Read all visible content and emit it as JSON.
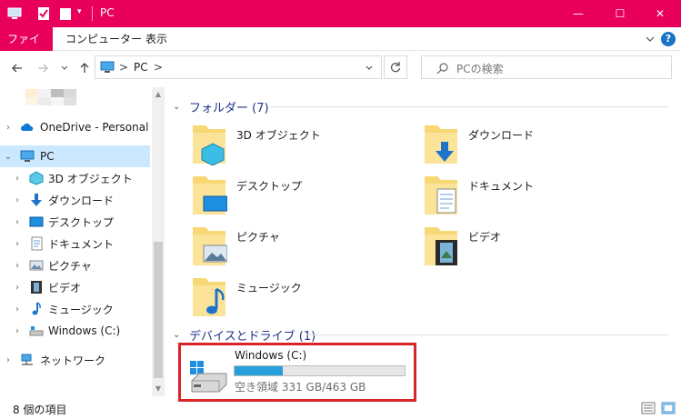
{
  "window": {
    "title": "PC",
    "minimize_glyph": "—",
    "maximize_glyph": "☐",
    "close_glyph": "✕",
    "accent": "#e8005a"
  },
  "ribbon": {
    "tabs": [
      "ファイル",
      "コンピューター",
      "表示"
    ],
    "help_label": "?"
  },
  "address": {
    "path": "PC",
    "separator": ">",
    "search_placeholder": "PCの検索"
  },
  "nav": {
    "items": [
      {
        "label": "OneDrive - Personal",
        "icon": "onedrive-icon"
      },
      {
        "label": "PC",
        "icon": "pc-icon"
      },
      {
        "label": "3D オブジェクト",
        "icon": "3d-objects-icon"
      },
      {
        "label": "ダウンロード",
        "icon": "download-icon"
      },
      {
        "label": "デスクトップ",
        "icon": "desktop-icon"
      },
      {
        "label": "ドキュメント",
        "icon": "documents-icon"
      },
      {
        "label": "ピクチャ",
        "icon": "pictures-icon"
      },
      {
        "label": "ビデオ",
        "icon": "videos-icon"
      },
      {
        "label": "ミュージック",
        "icon": "music-icon"
      },
      {
        "label": "Windows (C:)",
        "icon": "drive-icon"
      },
      {
        "label": "ネットワーク",
        "icon": "network-icon"
      }
    ]
  },
  "content": {
    "folders_header": "フォルダー (7)",
    "folders": [
      {
        "label": "3D オブジェクト",
        "icon": "3d-objects-folder-icon"
      },
      {
        "label": "ダウンロード",
        "icon": "downloads-folder-icon"
      },
      {
        "label": "デスクトップ",
        "icon": "desktop-folder-icon"
      },
      {
        "label": "ドキュメント",
        "icon": "documents-folder-icon"
      },
      {
        "label": "ピクチャ",
        "icon": "pictures-folder-icon"
      },
      {
        "label": "ビデオ",
        "icon": "videos-folder-icon"
      },
      {
        "label": "ミュージック",
        "icon": "music-folder-icon"
      }
    ],
    "drives_header": "デバイスとドライブ (1)",
    "drive": {
      "name": "Windows (C:)",
      "free_text": "空き領域 331 GB/463 GB",
      "used_fraction": 0.285,
      "bar_color": "#26a0da",
      "highlight_color": "#d9242a"
    }
  },
  "status": {
    "item_count": "8 個の項目"
  }
}
